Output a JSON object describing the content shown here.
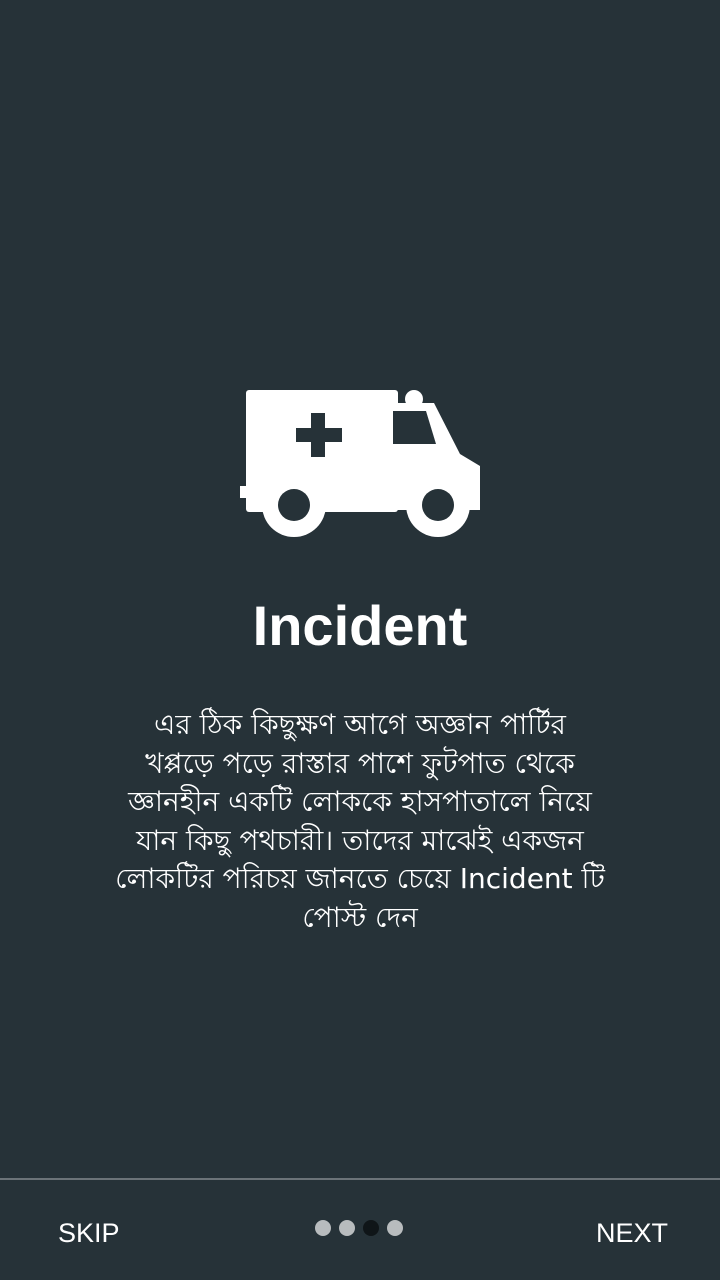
{
  "onboarding": {
    "title": "Incident",
    "description": "এর ঠিক কিছুক্ষণ আগে অজ্ঞান পার্টির\nখপ্পড়ে পড়ে রাস্তার পাশে ফুটপাত থেকে\nজ্ঞানহীন একটি লোককে হাসপাতালে নিয়ে\nযান কিছু পথচারী। তাদের মাঝেই একজন\nলোকটির পরিচয় জানতে চেয়ে Incident টি\nপোস্ট  দেন",
    "icon": "ambulance-icon"
  },
  "navigation": {
    "skip_label": "SKIP",
    "next_label": "NEXT",
    "page_count": 4,
    "current_page": 3
  },
  "colors": {
    "background": "#263238",
    "text": "#ffffff",
    "dot_inactive": "#b8bcbe",
    "dot_active": "#0f1518"
  }
}
